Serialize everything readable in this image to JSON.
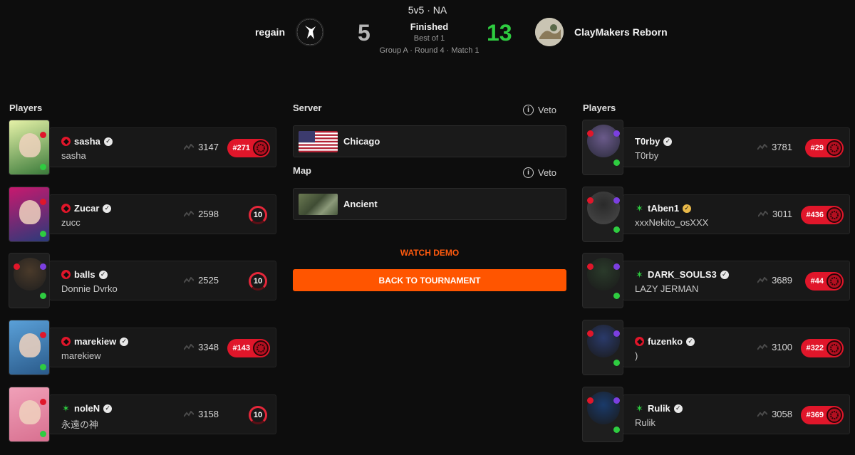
{
  "header": {
    "mode": "5v5 · NA",
    "status": "Finished",
    "best_of": "Best of 1",
    "round": "Group A · Round 4 · Match 1"
  },
  "team_left": {
    "name": "regain",
    "score": "5",
    "score_color": "#b5b5b5"
  },
  "team_right": {
    "name": "ClayMakers Reborn",
    "score": "13",
    "score_color": "#2ecc40"
  },
  "left_players_title": "Players",
  "right_players_title": "Players",
  "left_players": [
    {
      "name": "sasha",
      "real": "sasha",
      "elo": "3147",
      "rank": "#271",
      "level": "",
      "region": "faceit",
      "verified": "white"
    },
    {
      "name": "Zucar",
      "real": "zucc",
      "elo": "2598",
      "rank": "",
      "level": "10",
      "region": "faceit",
      "verified": "white"
    },
    {
      "name": "balls",
      "real": "Donnie Dvrko",
      "elo": "2525",
      "rank": "",
      "level": "10",
      "region": "faceit",
      "verified": "white"
    },
    {
      "name": "marekiew",
      "real": "marekiew",
      "elo": "3348",
      "rank": "#143",
      "level": "",
      "region": "faceit",
      "verified": "white"
    },
    {
      "name": "noleN",
      "real": "永遠の神",
      "elo": "3158",
      "rank": "",
      "level": "10",
      "region": "star",
      "verified": "white"
    }
  ],
  "right_players": [
    {
      "name": "T0rby",
      "real": "T0rby",
      "elo": "3781",
      "rank": "#29",
      "level": "",
      "region": "none",
      "verified": "white"
    },
    {
      "name": "tAben1",
      "real": "xxxNekito_osXXX",
      "elo": "3011",
      "rank": "#436",
      "level": "",
      "region": "star",
      "verified": "gold"
    },
    {
      "name": "DARK_SOULS3",
      "real": "LAZY JERMAN",
      "elo": "3689",
      "rank": "#44",
      "level": "",
      "region": "star",
      "verified": "white"
    },
    {
      "name": "fuzenko",
      "real": ")",
      "elo": "3100",
      "rank": "#322",
      "level": "",
      "region": "faceit",
      "verified": "white"
    },
    {
      "name": "Rulik",
      "real": "Rulik",
      "elo": "3058",
      "rank": "#369",
      "level": "",
      "region": "star",
      "verified": "white"
    }
  ],
  "server": {
    "title": "Server",
    "veto_label": "Veto",
    "value": "Chicago"
  },
  "map": {
    "title": "Map",
    "veto_label": "Veto",
    "value": "Ancient"
  },
  "actions": {
    "watch_demo": "WATCH DEMO",
    "back": "BACK TO TOURNAMENT"
  },
  "colors": {
    "accent": "#ff5500",
    "rank_red": "#e0162a",
    "win_green": "#2ecc40"
  }
}
